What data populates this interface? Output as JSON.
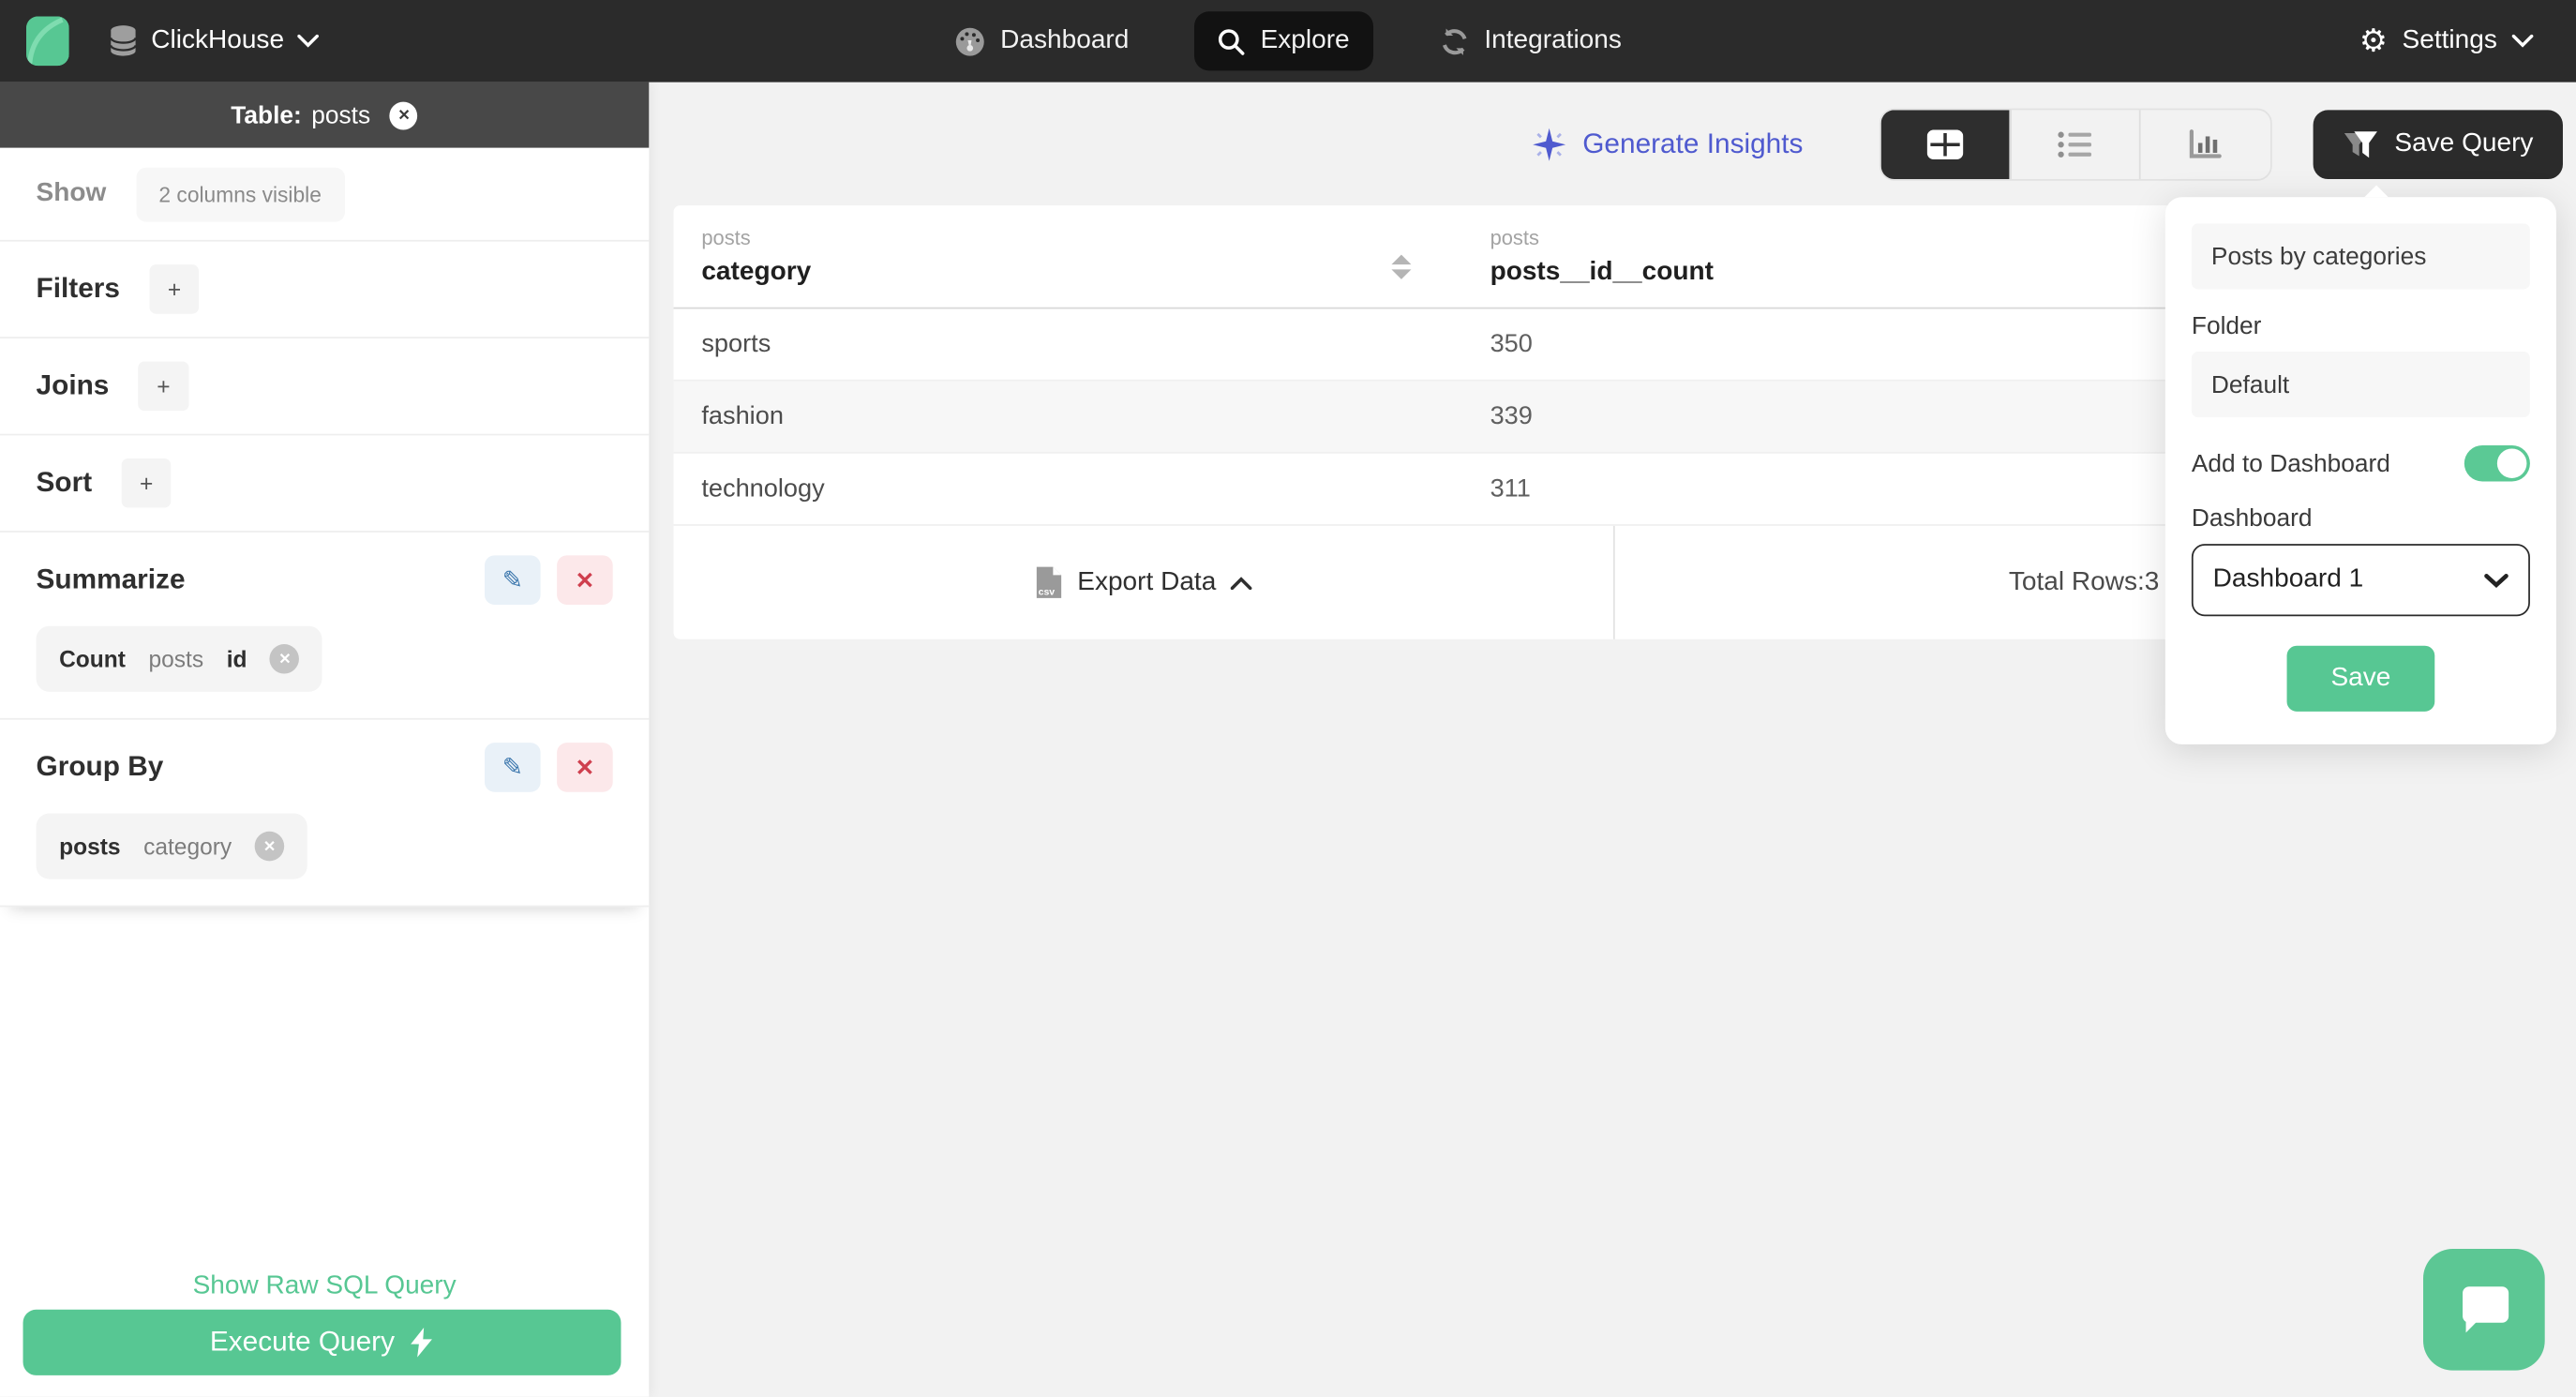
{
  "navbar": {
    "brand": "ClickHouse",
    "tabs": [
      {
        "label": "Dashboard",
        "icon": "gauge-icon",
        "active": false
      },
      {
        "label": "Explore",
        "icon": "search-icon",
        "active": true
      },
      {
        "label": "Integrations",
        "icon": "sync-icon",
        "active": false
      }
    ],
    "settings_label": "Settings"
  },
  "sidebar": {
    "table_header": {
      "prefix": "Table:",
      "table_name": "posts"
    },
    "show": {
      "label": "Show",
      "summary": "2 columns visible"
    },
    "sections": [
      {
        "label": "Filters",
        "action": "+"
      },
      {
        "label": "Joins",
        "action": "+"
      },
      {
        "label": "Sort",
        "action": "+"
      }
    ],
    "summarize": {
      "label": "Summarize",
      "chip": {
        "agg": "Count",
        "table": "posts",
        "column": "id"
      }
    },
    "group_by": {
      "label": "Group By",
      "chip": {
        "table": "posts",
        "column": "category"
      }
    },
    "raw_sql_link": "Show Raw SQL Query",
    "execute_button": "Execute Query"
  },
  "main": {
    "generate_insights": "Generate Insights",
    "save_query_label": "Save Query",
    "table": {
      "columns": [
        {
          "group": "posts",
          "name": "category"
        },
        {
          "group": "posts",
          "name": "posts__id__count"
        }
      ],
      "rows": [
        [
          "sports",
          "350"
        ],
        [
          "fashion",
          "339"
        ],
        [
          "technology",
          "311"
        ]
      ],
      "export_label": "Export Data",
      "total_rows": "Total Rows:3"
    }
  },
  "popover": {
    "query_name_value": "Posts by categories",
    "folder_label": "Folder",
    "folder_value": "Default",
    "add_to_dashboard_label": "Add to Dashboard",
    "toggle_state": "on",
    "dashboard_label": "Dashboard",
    "dashboard_value": "Dashboard 1",
    "save_label": "Save"
  },
  "colors": {
    "accent_green": "#57c793",
    "navbar_dark": "#2b2b2b",
    "active_pill": "#121212",
    "insights_indigo": "#4f5acf",
    "edit_blue": "#3c77ad",
    "delete_red": "#cf3f4e",
    "main_bg": "#f2f2f2"
  }
}
